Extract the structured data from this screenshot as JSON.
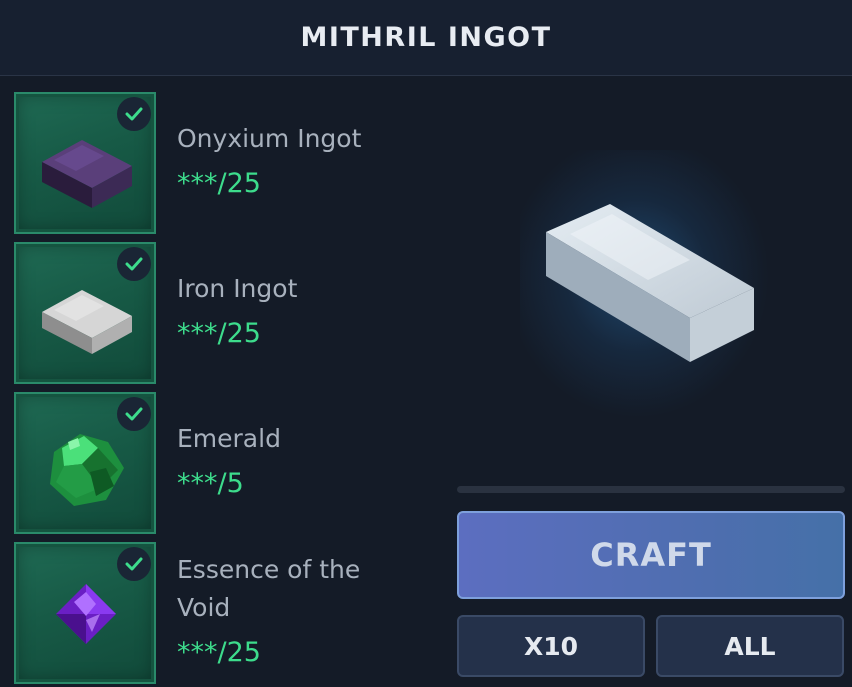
{
  "header": {
    "title": "MITHRIL INGOT"
  },
  "ingredients": [
    {
      "name": "Onyxium Ingot",
      "count": "***/25",
      "icon": "onyxium-ingot-icon",
      "satisfied": true
    },
    {
      "name": "Iron Ingot",
      "count": "***/25",
      "icon": "iron-ingot-icon",
      "satisfied": true
    },
    {
      "name": "Emerald",
      "count": "***/5",
      "icon": "emerald-icon",
      "satisfied": true
    },
    {
      "name": "Essence of the Void",
      "count": "***/25",
      "icon": "essence-of-the-void-icon",
      "satisfied": true
    }
  ],
  "result": {
    "icon": "mithril-ingot-icon"
  },
  "progress": {
    "fraction": 0
  },
  "actions": {
    "craft_label": "CRAFT",
    "x10_label": "X10",
    "all_label": "ALL"
  },
  "colors": {
    "background": "#141b27",
    "slot_green": "#1a5f4a",
    "check_green": "#3ddc8c",
    "count_green": "#3ddc8c",
    "craft_blue": "#5068b4"
  }
}
